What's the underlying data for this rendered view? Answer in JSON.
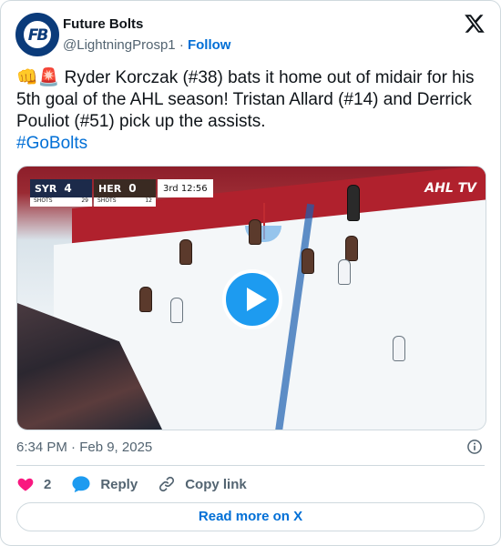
{
  "account": {
    "display_name": "Future Bolts",
    "handle": "@LightningProsp1",
    "separator": "·",
    "follow_label": "Follow",
    "avatar_text": "FB"
  },
  "tweet": {
    "emojis": "👊🚨",
    "text": "Ryder Korczak (#38) bats it home out of midair for his 5th goal of the AHL season! Tristan Allard (#14) and Derrick Pouliot (#51) pick up the assists.",
    "hashtag": "#GoBolts"
  },
  "video": {
    "scoreboard": {
      "home_team": "SYR",
      "home_score": "4",
      "home_shots_label": "SHOTS",
      "home_shots": "29",
      "away_team": "HER",
      "away_score": "0",
      "away_shots_label": "SHOTS",
      "away_shots": "12",
      "clock": "3rd 12:56"
    },
    "network": "AHL TV"
  },
  "meta": {
    "timestamp": "6:34 PM · Feb 9, 2025"
  },
  "actions": {
    "like_count": "2",
    "reply_label": "Reply",
    "copy_link_label": "Copy link"
  },
  "footer": {
    "read_more_label": "Read more on X"
  },
  "colors": {
    "accent": "#1d9bf0",
    "link": "#006fd6",
    "heart": "#f91880",
    "text_secondary": "#536471",
    "border": "#cfd9de"
  },
  "icons": [
    "x-logo-icon",
    "info-icon",
    "heart-icon",
    "reply-bubble-icon",
    "link-icon",
    "play-icon"
  ]
}
